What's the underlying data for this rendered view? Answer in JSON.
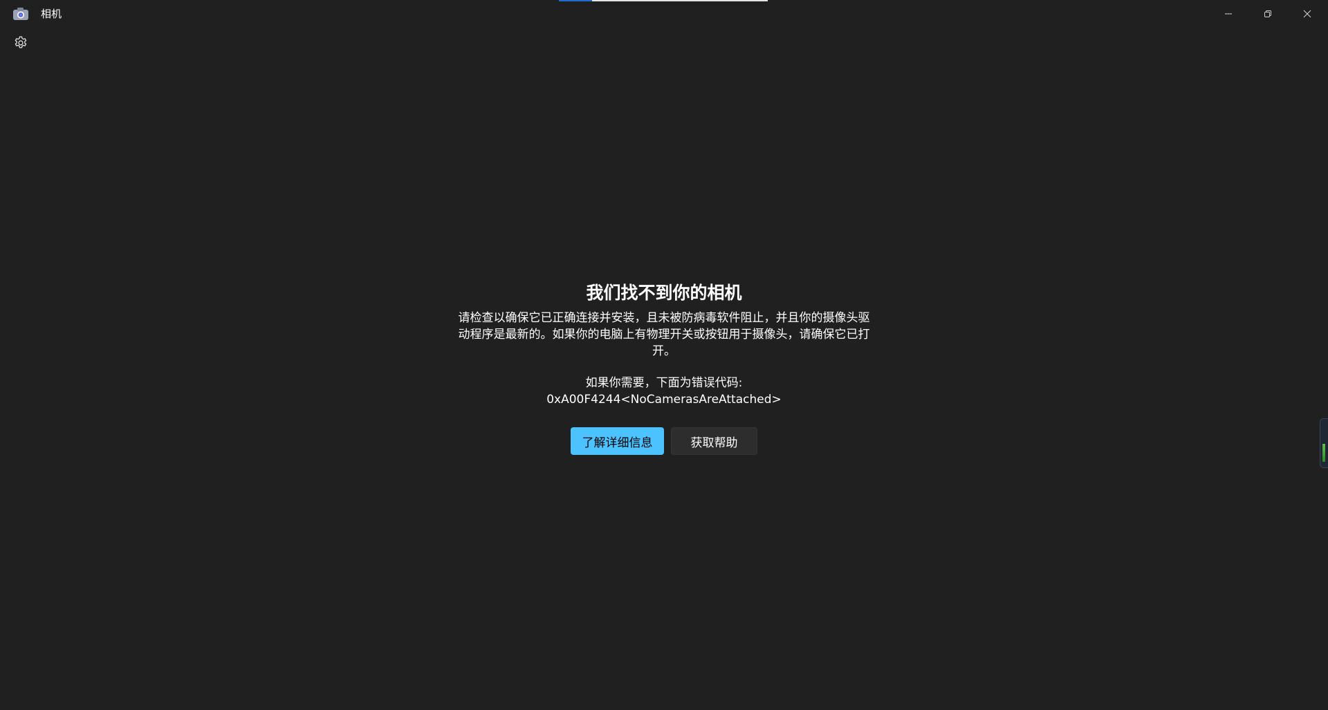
{
  "window": {
    "title": "相机",
    "progress_fraction": 0.16,
    "colors": {
      "background": "#202020",
      "accent": "#4cc2ff",
      "progress": "#1f6fd1"
    }
  },
  "icons": {
    "app": "camera-icon",
    "settings": "gear-icon",
    "minimize": "minimize-icon",
    "restore": "restore-icon",
    "close": "close-icon"
  },
  "error": {
    "title": "我们找不到你的相机",
    "body_line1": "请检查以确保它已正确连接并安装，且未被防病毒软件阻止，并且你的摄像头驱",
    "body_line2": "动程序是最新的。如果你的电脑上有物理开关或按钮用于摄像头，请确保它已打",
    "body_line3": "开。",
    "code_intro": "如果你需要，下面为错误代码:",
    "code": "0xA00F4244<NoCamerasAreAttached>"
  },
  "buttons": {
    "learn_more": "了解详细信息",
    "get_help": "获取帮助"
  }
}
